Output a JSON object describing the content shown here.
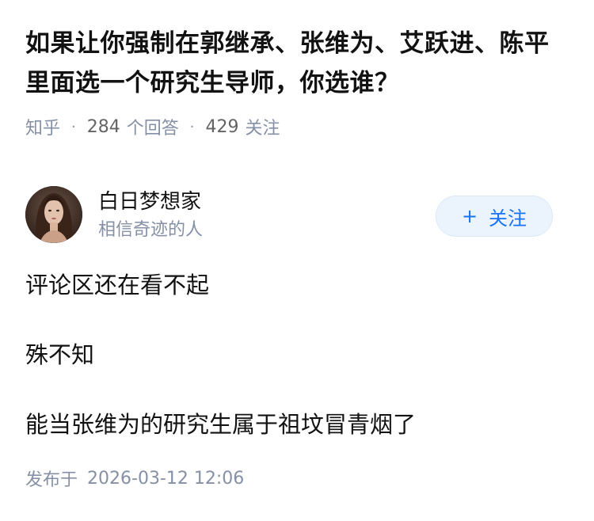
{
  "question": {
    "title": "如果让你强制在郭继承、张维为、艾跃进、陈平里面选一个研究生导师，你选谁？"
  },
  "meta": {
    "source": "知乎",
    "answer_count": "284",
    "answer_label": "个回答",
    "follower_count": "429",
    "follower_label": "关注"
  },
  "author": {
    "name": "白日梦想家",
    "bio": "相信奇迹的人",
    "follow_plus": "+",
    "follow_label": "关注"
  },
  "answer": {
    "paragraphs": [
      "评论区还在看不起",
      "殊不知",
      "能当张维为的研究生属于祖坟冒青烟了"
    ]
  },
  "publish": {
    "label": "发布于",
    "datetime": "2026-03-12 12:06"
  },
  "colors": {
    "title": "#121212",
    "muted": "#8590a6",
    "accent": "#1772f6",
    "follow_bg": "#ebf3fc"
  }
}
